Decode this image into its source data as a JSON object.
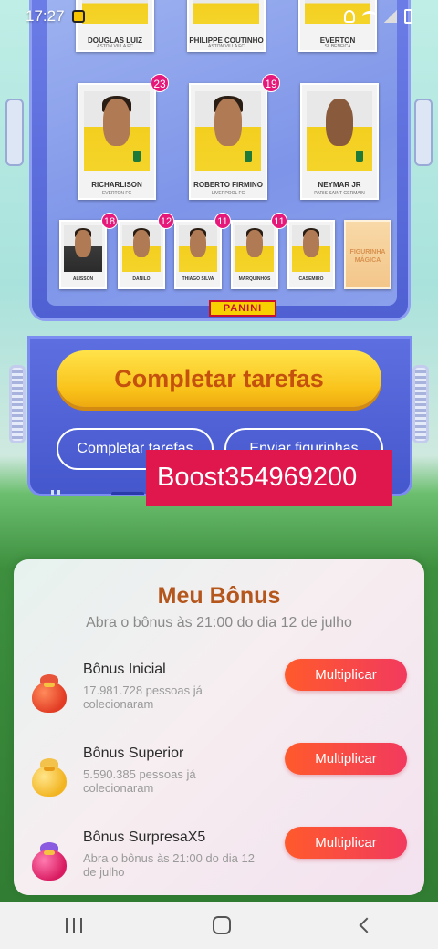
{
  "status_bar": {
    "time": "17:27",
    "icons": [
      "app-notification-icon",
      "mute-icon",
      "wifi-icon",
      "signal-icon",
      "battery-icon"
    ]
  },
  "album": {
    "stickers_top": [
      {
        "name": "DOUGLAS LUIZ",
        "sub": "ASTON VILLA FC"
      },
      {
        "name": "PHILIPPE COUTINHO",
        "sub": "ASTON VILLA FC"
      },
      {
        "name": "EVERTON",
        "sub": "SL BENFICA"
      }
    ],
    "stickers_mid": [
      {
        "name": "RICHARLISON",
        "sub": "EVERTON FC",
        "count": "23"
      },
      {
        "name": "ROBERTO FIRMINO",
        "sub": "LIVERPOOL FC",
        "count": "19"
      },
      {
        "name": "NEYMAR JR",
        "sub": "PARIS SAINT-GERMAIN"
      }
    ],
    "stickers_small": [
      {
        "name": "ALISSON",
        "count": "18"
      },
      {
        "name": "DANILO",
        "count": "12"
      },
      {
        "name": "THIAGO SILVA",
        "count": "11"
      },
      {
        "name": "MARQUINHOS",
        "count": "11"
      },
      {
        "name": "CASEMIRO"
      }
    ],
    "magic_sticker": {
      "line1": "FIGURINHA",
      "line2": "MÁGICA"
    },
    "brand": "PANINI"
  },
  "actions": {
    "primary_label": "Completar tarefas",
    "secondary_left": "Completar tarefas",
    "secondary_right": "Enviar figurinhas"
  },
  "overlay_label": "Boost354969200",
  "bonus": {
    "title": "Meu Bônus",
    "subtitle": "Abra o bônus às 21:00 do dia 12 de julho",
    "items": [
      {
        "name": "Bônus Inicial",
        "desc": "17.981.728 pessoas já colecionaram",
        "button": "Multiplicar",
        "bag_icon": "money-bag-red-icon"
      },
      {
        "name": "Bônus Superior",
        "desc": "5.590.385 pessoas já colecionaram",
        "button": "Multiplicar",
        "bag_icon": "money-bag-gold-icon"
      },
      {
        "name": "Bônus SurpresaX5",
        "desc": "Abra o bônus às 21:00 do dia 12 de julho",
        "button": "Multiplicar",
        "bag_icon": "money-bag-pink-icon"
      }
    ]
  },
  "colors": {
    "accent_orange": "#b5561c",
    "button_gradient_start": "#ff5a2c",
    "button_gradient_end": "#f23a5e",
    "primary_yellow": "#f9c21a",
    "overlay_red": "#e0174c",
    "frame_blue": "#5d6fe0"
  }
}
